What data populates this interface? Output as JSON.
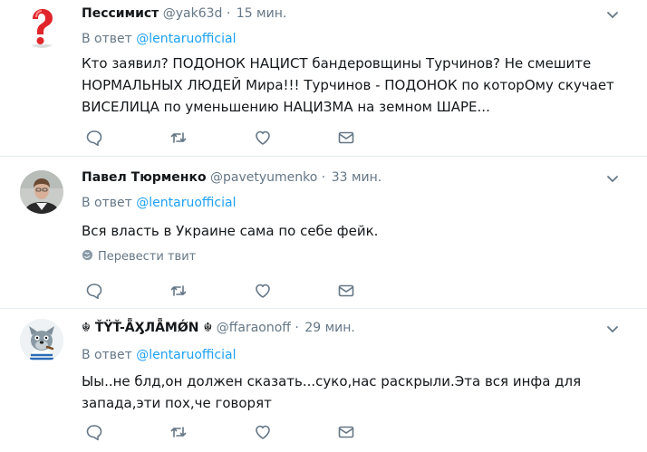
{
  "tweets": [
    {
      "name": "Пессимист",
      "handle": "@yak63d",
      "dot": "·",
      "time": "15 мин.",
      "reply_prefix": "В ответ",
      "reply_to": "@lentaruofficial",
      "text": "Кто заявил? ПОДОНОК НАЦИСТ бандеровщины Турчинов? Не смешите НОРМАЛЬНЫХ ЛЮДЕЙ Мира!!! Турчинов - ПОДОНОК по которОму скучает ВИСЕЛИЦА по уменьшению НАЦИЗМА на земном ШАРЕ...",
      "avatar_icon": "question-mark-icon"
    },
    {
      "name": "Павел Тюрменко",
      "handle": "@pavetyumenko",
      "dot": "·",
      "time": "33 мин.",
      "reply_prefix": "В ответ",
      "reply_to": "@lentaruofficial",
      "text": "Вся власть в Украине сама по себе фейк.",
      "translate": "Перевести твит",
      "avatar_icon": "person-photo"
    },
    {
      "name": "☬ ŤŸŤ-ǞӼЛǞMǾN ☬",
      "handle": "@ffaraonoff",
      "dot": "·",
      "time": "29 мин.",
      "reply_prefix": "В ответ",
      "reply_to": "@lentaruofficial",
      "text": "Ыы..не блд,он должен сказать...суко,нас раскрыли.Эта вся инфа для запада,эти пох,че говорят",
      "avatar_icon": "cartoon-wolf"
    }
  ],
  "colors": {
    "link": "#1da1f2",
    "muted": "#657786",
    "text": "#14171a",
    "divider": "#e6ecf0"
  }
}
